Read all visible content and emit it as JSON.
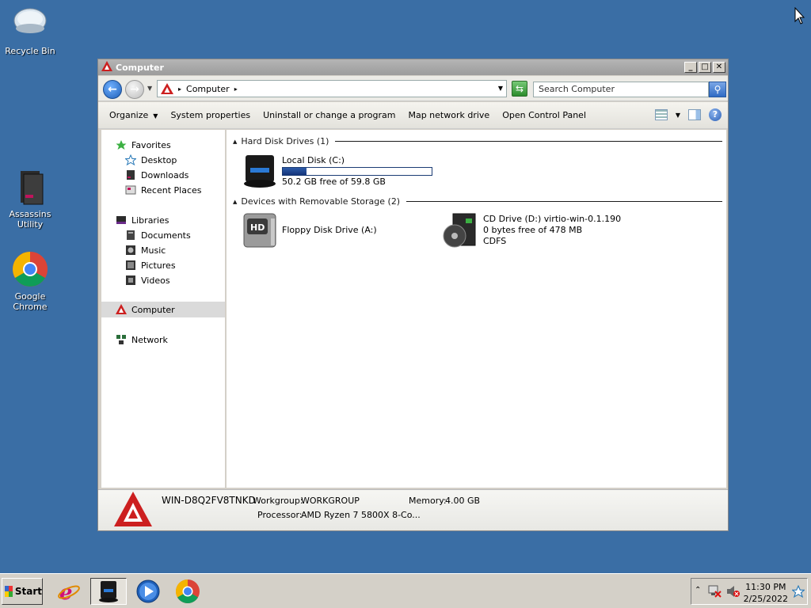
{
  "desktop": {
    "icons": [
      {
        "label": "Recycle Bin",
        "icon": "recycle-bin-icon"
      },
      {
        "label": "Assassins Utility",
        "icon": "folder-icon"
      },
      {
        "label": "Google Chrome",
        "icon": "chrome-icon"
      }
    ]
  },
  "window": {
    "title": "Computer",
    "controls": {
      "minimize": "_",
      "maximize": "□",
      "close": "✕"
    },
    "address": {
      "crumb": "Computer"
    },
    "search": {
      "placeholder": "Search Computer"
    },
    "toolbar": {
      "organize": "Organize",
      "system_properties": "System properties",
      "uninstall": "Uninstall or change a program",
      "map_drive": "Map network drive",
      "control_panel": "Open Control Panel"
    },
    "nav": {
      "favorites": "Favorites",
      "desktop": "Desktop",
      "downloads": "Downloads",
      "recent": "Recent Places",
      "libraries": "Libraries",
      "documents": "Documents",
      "music": "Music",
      "pictures": "Pictures",
      "videos": "Videos",
      "computer": "Computer",
      "network": "Network"
    },
    "groups": {
      "hdd": "Hard Disk Drives (1)",
      "removable": "Devices with Removable Storage (2)"
    },
    "drives": {
      "c": {
        "name": "Local Disk (C:)",
        "free": "50.2 GB free of 59.8 GB",
        "used_fraction": 0.16
      },
      "a": {
        "name": "Floppy Disk Drive (A:)"
      },
      "d": {
        "name": "CD Drive (D:) virtio-win-0.1.190",
        "free": "0 bytes free of 478 MB",
        "fs": "CDFS"
      }
    },
    "details": {
      "computer_name": "WIN-D8Q2FV8TNKD",
      "workgroup_label": "Workgroup:",
      "workgroup": "WORKGROUP",
      "memory_label": "Memory:",
      "memory": "4.00 GB",
      "processor_label": "Processor:",
      "processor": "AMD Ryzen 7 5800X 8-Co..."
    }
  },
  "taskbar": {
    "start": "Start",
    "time": "11:30 PM",
    "date": "2/25/2022"
  },
  "colors": {
    "desktop": "#3a6ea5",
    "accent": "#cc1f1f"
  }
}
